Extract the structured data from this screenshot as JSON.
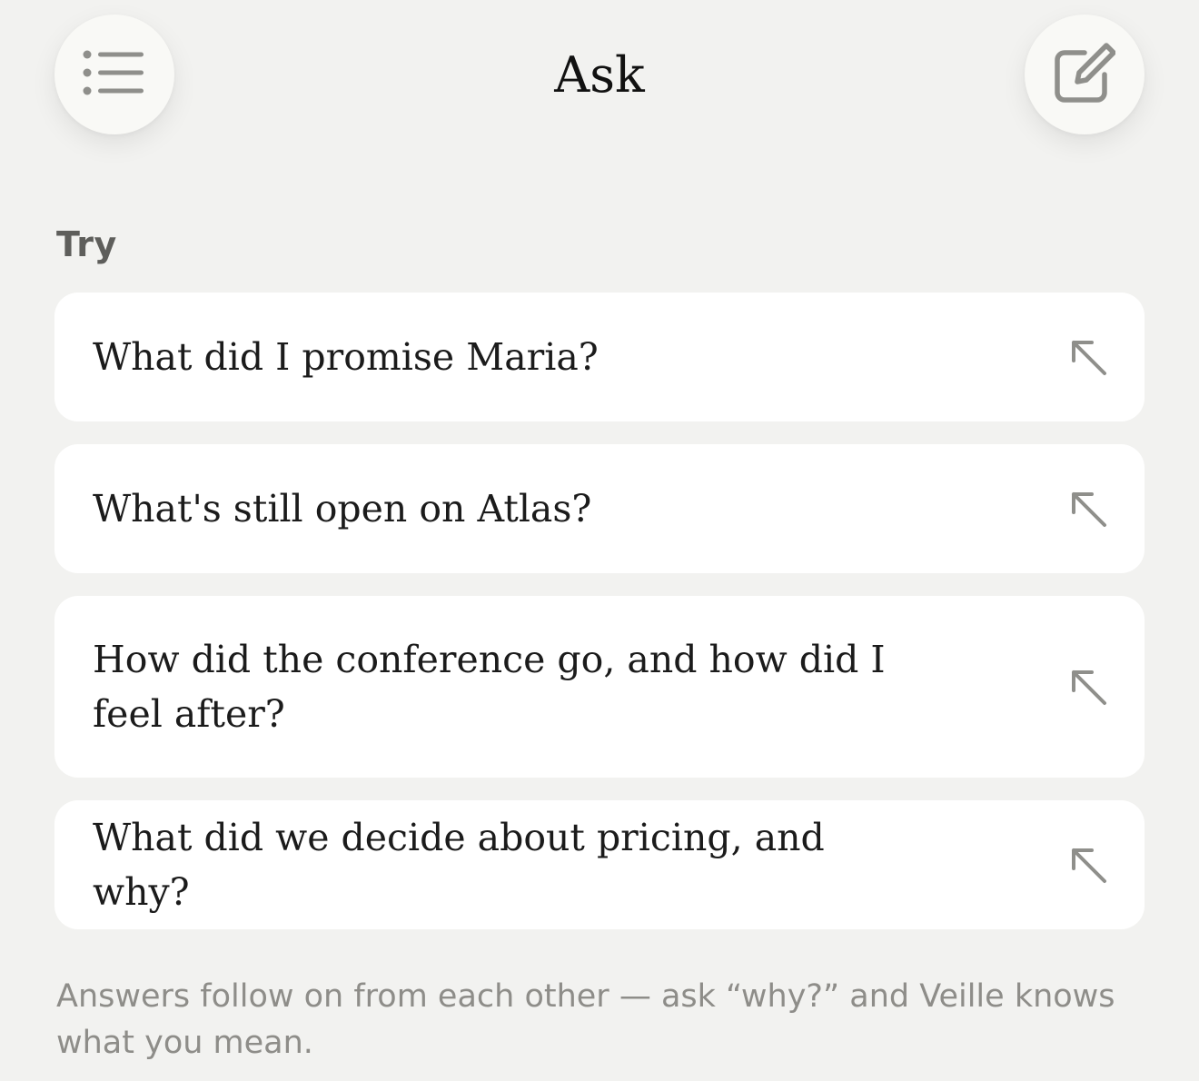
{
  "header": {
    "title": "Ask",
    "menu_icon": "list-icon",
    "compose_icon": "compose-icon"
  },
  "try_section": {
    "label": "Try",
    "suggestions": [
      {
        "text": "What did I promise Maria?",
        "icon": "arrow-up-left-icon"
      },
      {
        "text": "What's still open on Atlas?",
        "icon": "arrow-up-left-icon"
      },
      {
        "text": "How did the conference go, and how did I feel after?",
        "icon": "arrow-up-left-icon"
      },
      {
        "text": "What did we decide about pricing, and why?",
        "icon": "arrow-up-left-icon"
      }
    ]
  },
  "footer": {
    "note": "Answers follow on from each other — ask “why?” and Veille knows what you mean."
  },
  "colors": {
    "background": "#f2f2f0",
    "card": "#ffffff",
    "icon": "#8f8f8b",
    "muted_text": "#8e8d89"
  }
}
